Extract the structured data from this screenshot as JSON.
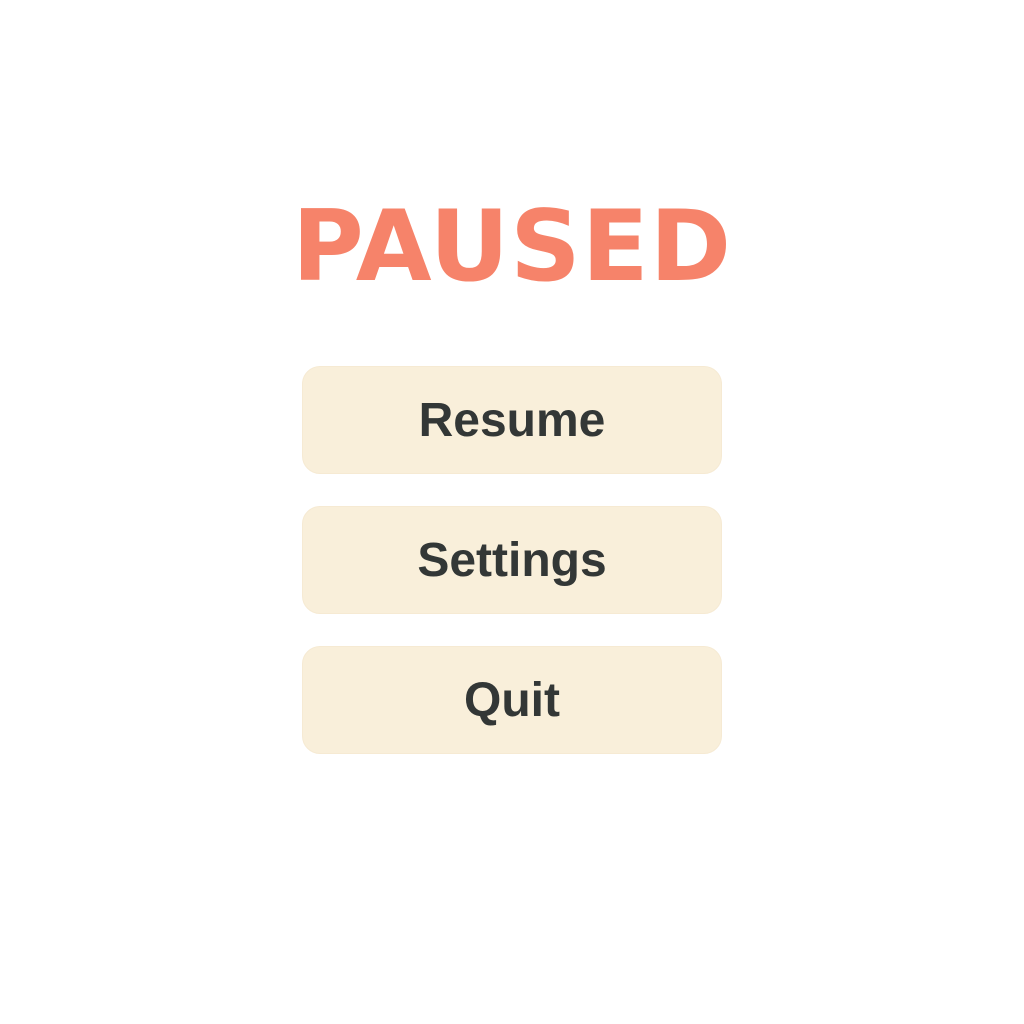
{
  "pause_menu": {
    "title": "PAUSED",
    "buttons": [
      {
        "label": "Resume"
      },
      {
        "label": "Settings"
      },
      {
        "label": "Quit"
      }
    ]
  },
  "colors": {
    "title": "#f6836a",
    "button_background": "#f9efda",
    "button_text": "#333736",
    "background": "#ffffff"
  }
}
